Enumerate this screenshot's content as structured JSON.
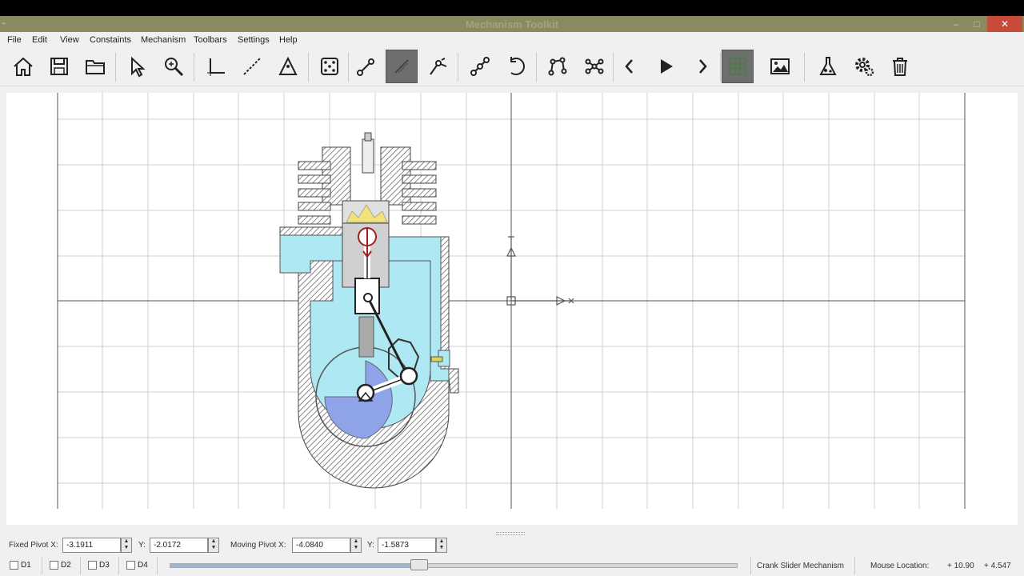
{
  "window": {
    "title": "Mechanism Toolkit",
    "controls": {
      "minimize": "–",
      "maximize": "□",
      "close": "✕"
    },
    "colors": {
      "titlebar": "#8a8a62",
      "close": "#c74a3a",
      "accent_active_tool": "#6e6e6e"
    }
  },
  "menu": {
    "items": [
      "File",
      "Edit",
      "View",
      "Constaints",
      "Mechanism",
      "Toolbars",
      "Settings",
      "Help"
    ]
  },
  "toolbar": {
    "tools": [
      {
        "icon": "home-icon"
      },
      {
        "icon": "save-icon"
      },
      {
        "icon": "open-folder-icon"
      },
      {
        "icon": "select-arrow-icon"
      },
      {
        "icon": "zoom-icon"
      },
      {
        "icon": "axis-icon"
      },
      {
        "icon": "line-icon"
      },
      {
        "icon": "triangle-icon"
      },
      {
        "icon": "dice-icon"
      },
      {
        "icon": "link-joint-icon"
      },
      {
        "icon": "pen-link-icon",
        "active": true
      },
      {
        "icon": "lift-link-icon"
      },
      {
        "icon": "multi-link-icon"
      },
      {
        "icon": "undo-icon"
      },
      {
        "icon": "four-bar-icon"
      },
      {
        "icon": "network-icon"
      },
      {
        "icon": "previous-icon"
      },
      {
        "icon": "play-icon"
      },
      {
        "icon": "next-icon"
      },
      {
        "icon": "grid-icon",
        "active": true
      },
      {
        "icon": "image-icon"
      },
      {
        "icon": "flask-icon"
      },
      {
        "icon": "settings-gear-icon"
      },
      {
        "icon": "trash-icon"
      }
    ]
  },
  "pivots": {
    "fixed_label": "Fixed Pivot X:",
    "fixed_x": "-3.1911",
    "fixed_y_label": "Y:",
    "fixed_y": "-2.0172",
    "moving_label": "Moving Pivot X:",
    "moving_x": "-4.0840",
    "moving_y_label": "Y:",
    "moving_y": "-1.5873"
  },
  "displays": [
    {
      "label": "D1",
      "checked": false
    },
    {
      "label": "D2",
      "checked": false
    },
    {
      "label": "D3",
      "checked": false
    },
    {
      "label": "D4",
      "checked": false
    }
  ],
  "animation": {
    "progress": 0.44
  },
  "status": {
    "mechanism_name": "Crank Slider Mechanism",
    "mouse_label": "Mouse Location:",
    "mouse_x": "+ 10.90",
    "mouse_y": "+ 4.547"
  }
}
